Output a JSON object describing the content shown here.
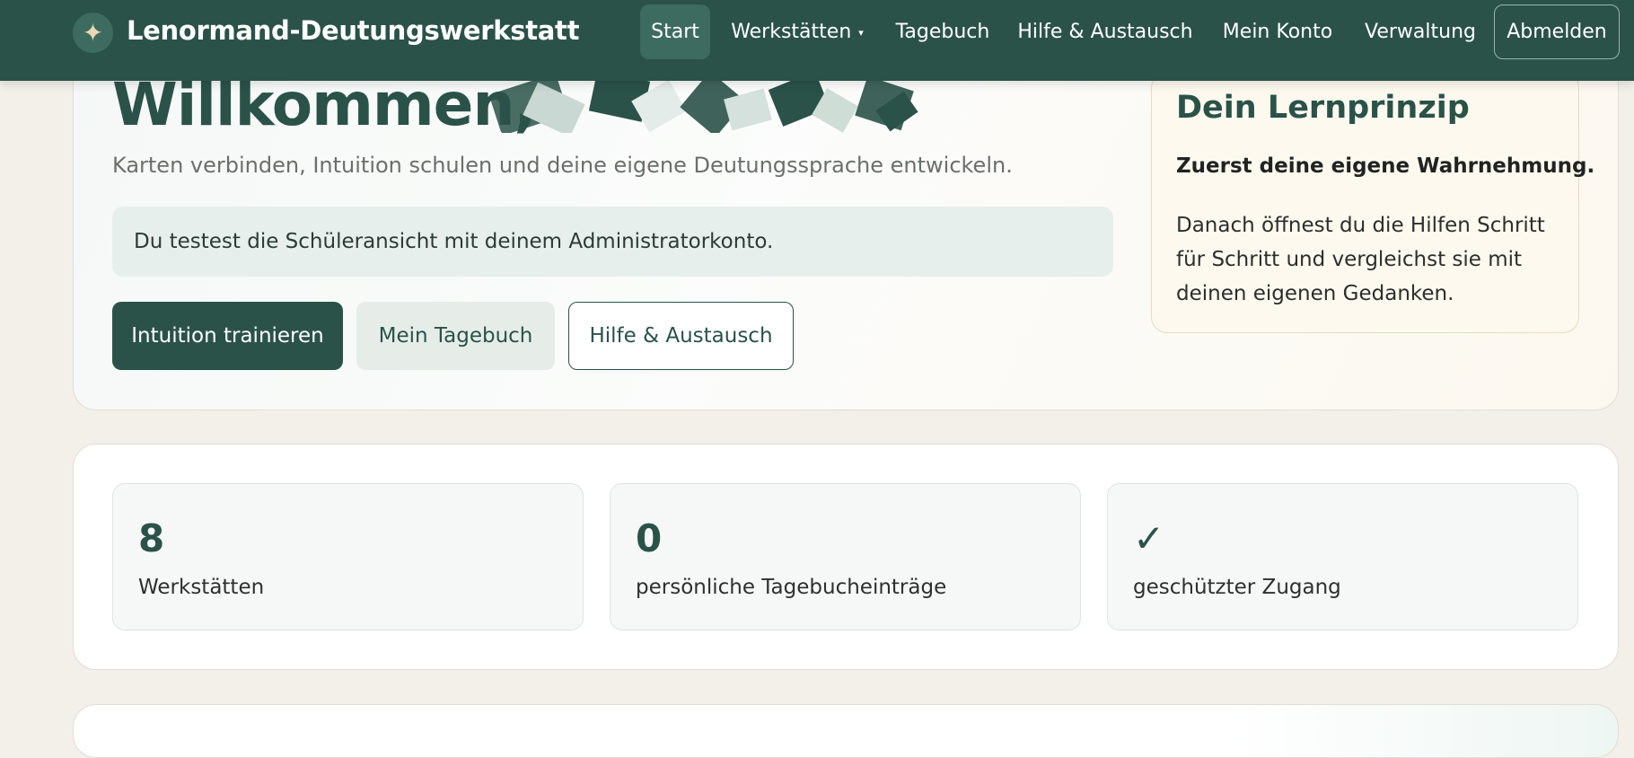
{
  "header": {
    "brand_mark": "✦",
    "brand_icon": "sparkle-icon",
    "brand_name": "Lenormand-Deutungswerkstatt",
    "nav": {
      "start": "Start",
      "workshops": "Werkstätten",
      "workshops_caret": "▾",
      "journal": "Tagebuch",
      "help": "Hilfe & Austausch",
      "account": "Mein Konto",
      "admin": "Verwaltung",
      "logout": "Abmelden"
    },
    "active_item": "Start"
  },
  "welcome": {
    "title": "Willkommen,",
    "subtitle": "Karten verbinden, Intuition schulen und deine eigene Deutungssprache entwickeln.",
    "notice": "Du testest die Schüleransicht mit deinem Administratorkonto.",
    "buttons": {
      "primary": "Intuition trainieren",
      "secondary": "Mein Tagebuch",
      "outline": "Hilfe & Austausch"
    }
  },
  "principle": {
    "title": "Dein Lernprinzip",
    "lead": "Zuerst deine eigene Wahrnehmung.",
    "text": "Danach öffnest du die Hilfen Schritt für Schritt und vergleichst sie mit deinen eigenen Gedanken."
  },
  "stats": [
    {
      "value": "8",
      "label": "Werkstätten"
    },
    {
      "value": "0",
      "label": "persönliche Tagebucheinträge"
    },
    {
      "value": "✓",
      "label": "geschützter Zugang"
    }
  ],
  "colors": {
    "primary": "#2a5249",
    "background": "#f3efe9",
    "notice_bg": "#e7efec",
    "principle_bg": "#fdf9ef"
  }
}
